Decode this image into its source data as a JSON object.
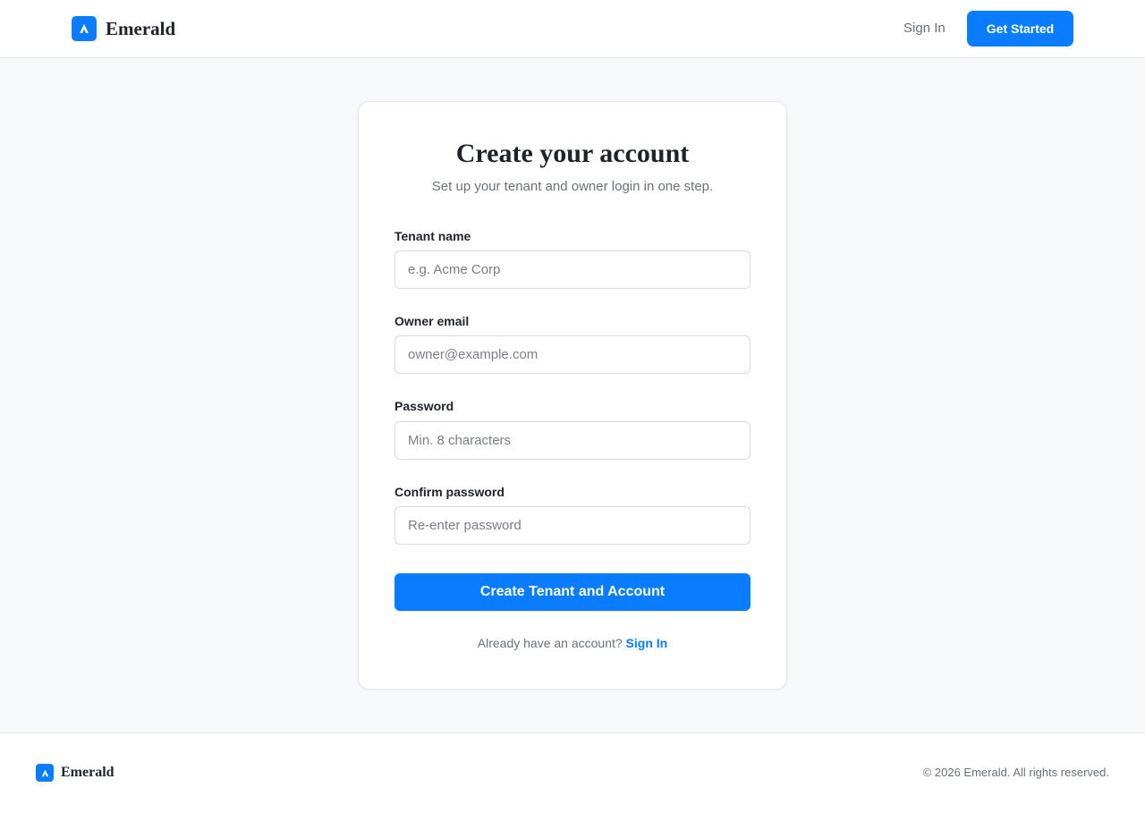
{
  "header": {
    "brand_name": "Emerald",
    "logo_icon": "emerald-logo-icon",
    "signin_label": "Sign In",
    "cta_label": "Get Started"
  },
  "form": {
    "title": "Create your account",
    "subtitle": "Set up your tenant and owner login in one step.",
    "fields": [
      {
        "label": "Tenant name",
        "placeholder": "e.g. Acme Corp",
        "value": ""
      },
      {
        "label": "Owner email",
        "placeholder": "owner@example.com",
        "value": ""
      },
      {
        "label": "Password",
        "placeholder": "Min. 8 characters",
        "value": ""
      },
      {
        "label": "Confirm password",
        "placeholder": "Re-enter password",
        "value": ""
      }
    ],
    "submit_label": "Create Tenant and Account",
    "signin_prompt": "Already have an account?",
    "signin_link": "Sign In"
  },
  "footer": {
    "brand_name": "Emerald",
    "copyright": "© 2026 Emerald. All rights reserved."
  },
  "colors": {
    "accent": "#0a7cff",
    "background": "#f7f8fa",
    "text": "#1f2328",
    "muted": "#6b7178"
  }
}
